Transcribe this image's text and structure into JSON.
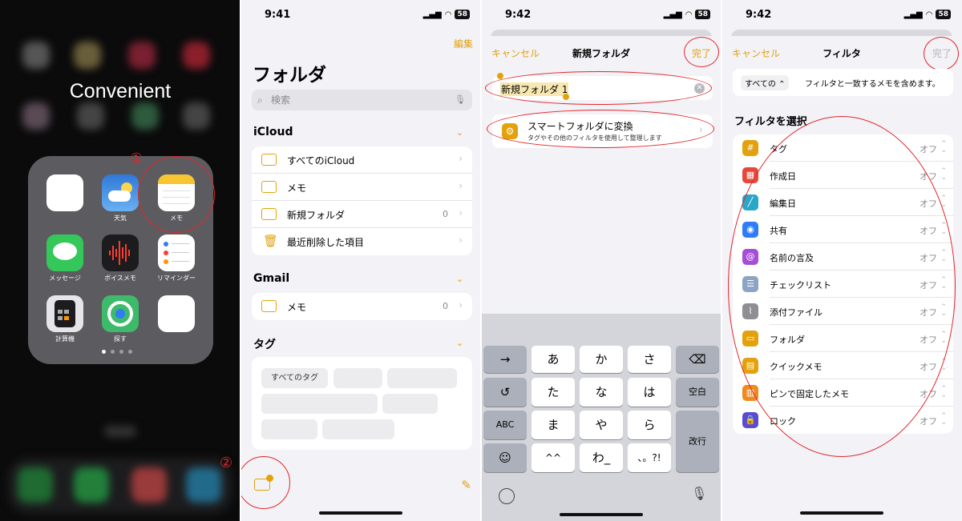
{
  "panel1": {
    "folder_title": "Convenient",
    "apps": [
      {
        "label": ""
      },
      {
        "label": "天気"
      },
      {
        "label": "メモ"
      },
      {
        "label": "メッセージ"
      },
      {
        "label": "ボイスメモ"
      },
      {
        "label": "リマインダー"
      },
      {
        "label": "計算機"
      },
      {
        "label": "探す"
      },
      {
        "label": ""
      }
    ]
  },
  "annotations": [
    "①",
    "②",
    "③",
    "④",
    "⑤"
  ],
  "panel2": {
    "time": "9:41",
    "battery": "58",
    "edit": "編集",
    "title": "フォルダ",
    "search_placeholder": "検索",
    "icloud_header": "iCloud",
    "icloud_rows": [
      {
        "label": "すべてのiCloud",
        "count": ""
      },
      {
        "label": "メモ",
        "count": ""
      },
      {
        "label": "新規フォルダ",
        "count": "0"
      },
      {
        "label": "最近削除した項目",
        "count": ""
      }
    ],
    "gmail_header": "Gmail",
    "gmail_rows": [
      {
        "label": "メモ",
        "count": "0"
      }
    ],
    "tags_header": "タグ",
    "all_tags": "すべてのタグ"
  },
  "panel3": {
    "time": "9:42",
    "battery": "58",
    "cancel": "キャンセル",
    "title": "新規フォルダ",
    "done": "完了",
    "folder_name": "新規フォルダ 1",
    "smart_title": "スマートフォルダに変換",
    "smart_sub": "タグやその他のフィルタを使用して整理します",
    "keys": {
      "arrow": "→",
      "a": "あ",
      "ka": "か",
      "sa": "さ",
      "del": "⌫",
      "undo": "↺",
      "ta": "た",
      "na": "な",
      "ha": "は",
      "space": "空白",
      "abc": "ABC",
      "ma": "ま",
      "ya": "や",
      "ra": "ら",
      "enter": "改行",
      "emoji": "☺",
      "kao": "^^",
      "wa": "わ_",
      "punct": "、。?!"
    }
  },
  "panel4": {
    "time": "9:42",
    "battery": "58",
    "cancel": "キャンセル",
    "title": "フィルタ",
    "done": "完了",
    "include_select": "すべての ⌃",
    "include_text": "フィルタと一致するメモを含めます。",
    "select_header": "フィルタを選択",
    "filters": [
      {
        "label": "タグ",
        "value": "オフ",
        "color": "#e3a20c",
        "icon": "#"
      },
      {
        "label": "作成日",
        "value": "オフ",
        "color": "#e5483b",
        "icon": "▦"
      },
      {
        "label": "編集日",
        "value": "オフ",
        "color": "#2aa6c9",
        "icon": "╱"
      },
      {
        "label": "共有",
        "value": "オフ",
        "color": "#2f7cf6",
        "icon": "◉"
      },
      {
        "label": "名前の言及",
        "value": "オフ",
        "color": "#a64fd6",
        "icon": "@"
      },
      {
        "label": "チェックリスト",
        "value": "オフ",
        "color": "#8da4c4",
        "icon": "☰"
      },
      {
        "label": "添付ファイル",
        "value": "オフ",
        "color": "#8e8e93",
        "icon": "⌇"
      },
      {
        "label": "フォルダ",
        "value": "オフ",
        "color": "#e3a20c",
        "icon": "▭"
      },
      {
        "label": "クイックメモ",
        "value": "オフ",
        "color": "#e3a20c",
        "icon": "▤"
      },
      {
        "label": "ピンで固定したメモ",
        "value": "オフ",
        "color": "#ef8a1f",
        "icon": "▥"
      },
      {
        "label": "ロック",
        "value": "オフ",
        "color": "#5b4bd1",
        "icon": "🔒"
      }
    ]
  }
}
